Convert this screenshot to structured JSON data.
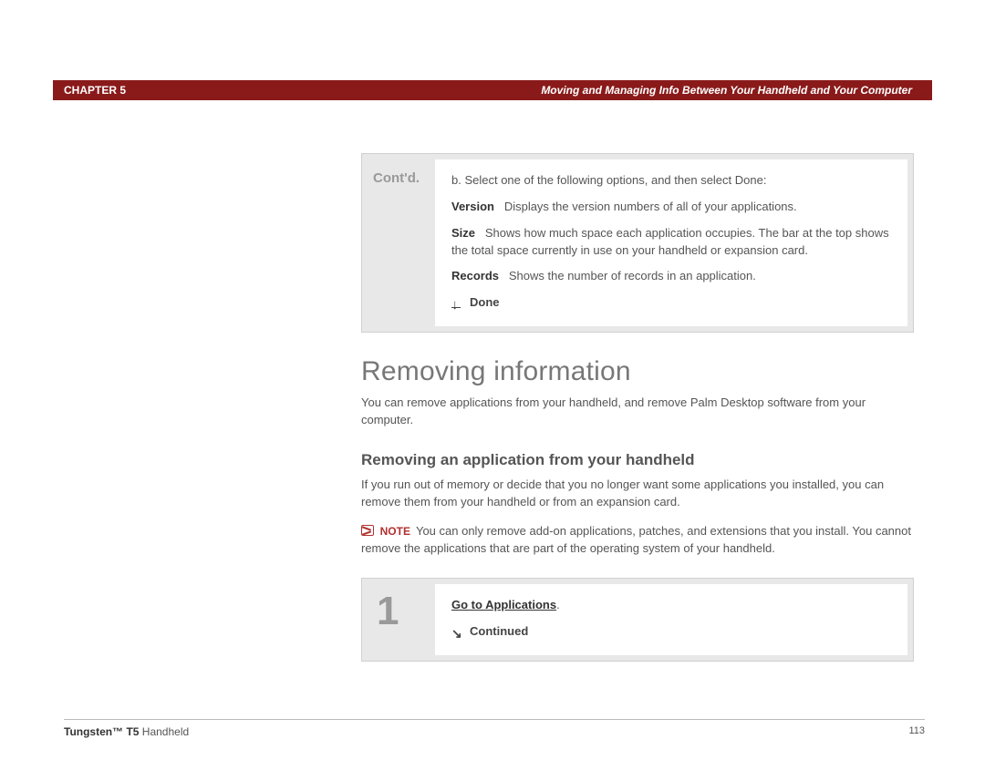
{
  "header": {
    "chapter": "CHAPTER 5",
    "title": "Moving and Managing Info Between Your Handheld and Your Computer"
  },
  "box1": {
    "label": "Cont'd.",
    "intro": "b.  Select one of the following options, and then select Done:",
    "defs": {
      "version_term": "Version",
      "version_desc": "Displays the version numbers of all of your applications.",
      "size_term": "Size",
      "size_desc": "Shows how much space each application occupies. The bar at the top shows the total space currently in use on your handheld or expansion card.",
      "records_term": "Records",
      "records_desc": "Shows the number of records in an application."
    },
    "done": "Done"
  },
  "section": {
    "title": "Removing information",
    "para": "You can remove applications from your handheld, and remove Palm Desktop software from your computer."
  },
  "subsection": {
    "title": "Removing an application from your handheld",
    "para": "If you run out of memory or decide that you no longer want some applications you installed, you can remove them from your handheld or from an expansion card.",
    "note_label": "NOTE",
    "note_text": "You can only remove add-on applications, patches, and extensions that you install. You cannot remove the applications that are part of the operating system of your handheld."
  },
  "box2": {
    "num": "1",
    "link": "Go to Applications",
    "continued": "Continued"
  },
  "footer": {
    "product_bold": "Tungsten™ T5",
    "product_rest": " Handheld",
    "page": "113"
  }
}
